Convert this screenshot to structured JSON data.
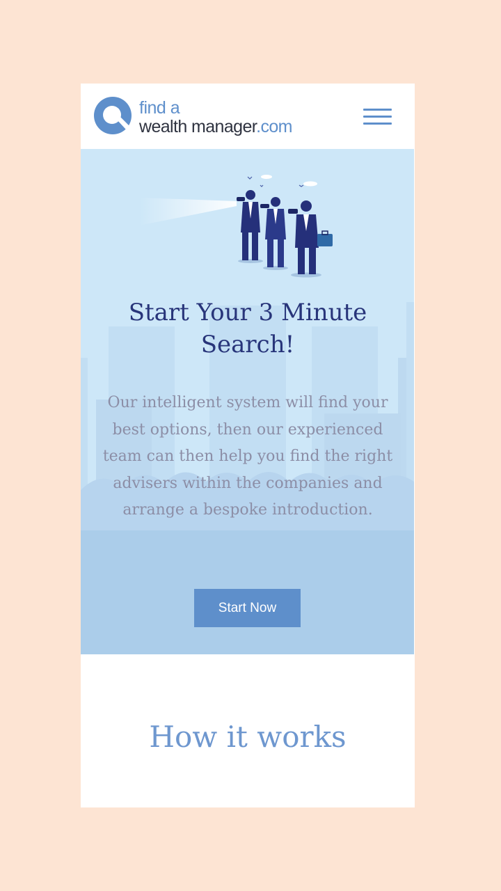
{
  "logo": {
    "line1": "find a",
    "line2_main": "wealth manager",
    "line2_tld": ".com"
  },
  "colors": {
    "page_bg": "#fde4d3",
    "brand_blue": "#5e8fcb",
    "title_navy": "#28357a",
    "hero_bg": "#cde7f8",
    "body_text": "#8c8ea6"
  },
  "icons": {
    "logo": "magnifier-logo-icon",
    "menu": "hamburger-menu-icon"
  },
  "hero": {
    "title": "Start Your 3 Minute Search!",
    "description": "Our intelligent system will find your best options, then our experienced team can then help you find the right advisers within the companies and arrange a bespoke introduction.",
    "cta_label": "Start Now"
  },
  "how_it_works": {
    "title": "How it works"
  }
}
